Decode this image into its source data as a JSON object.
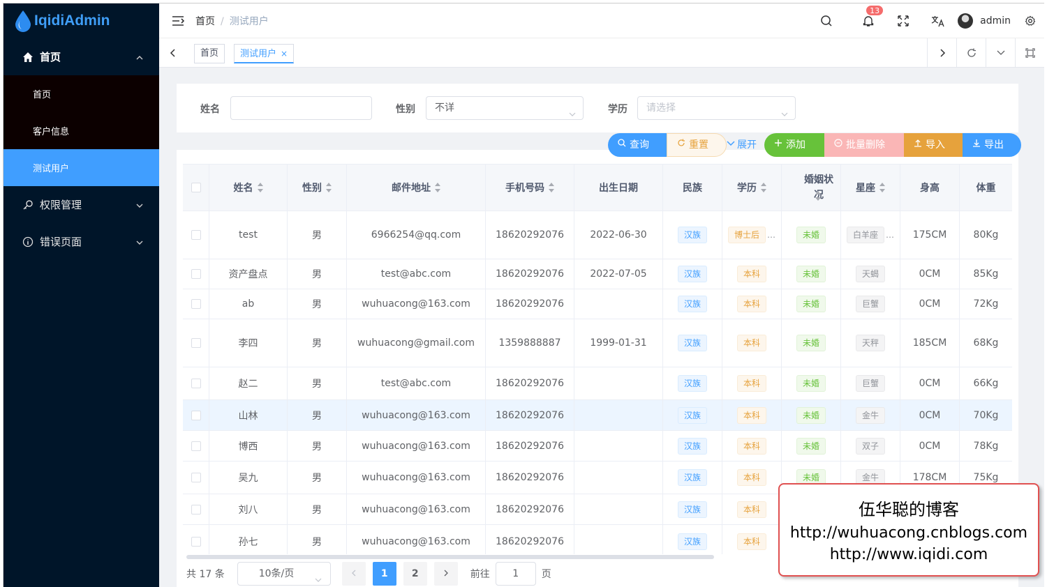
{
  "app": {
    "title": "IqidiAdmin"
  },
  "sidebar": {
    "home": "首页",
    "sub_items": [
      "首页",
      "客户信息",
      "测试用户"
    ],
    "permissions": "权限管理",
    "errors": "错误页面"
  },
  "header": {
    "breadcrumb_home": "首页",
    "breadcrumb_sep": "/",
    "breadcrumb_current": "测试用户",
    "notify_count": "13",
    "username": "admin"
  },
  "tags": {
    "home": "首页",
    "current": "测试用户",
    "close": "×"
  },
  "search": {
    "name_label": "姓名",
    "name_value": "",
    "gender_label": "性别",
    "gender_value": "不详",
    "edu_label": "学历",
    "edu_placeholder": "请选择"
  },
  "buttons": {
    "query": "查询",
    "reset": "重置",
    "expand": "展开",
    "add": "添加",
    "batch_delete": "批量删除",
    "import": "导入",
    "export": "导出"
  },
  "table": {
    "headers": [
      "姓名",
      "性别",
      "邮件地址",
      "手机号码",
      "出生日期",
      "民族",
      "学历",
      "婚姻状况",
      "星座",
      "身高",
      "体重"
    ],
    "rows": [
      {
        "name": "test",
        "gender": "男",
        "email": "6966254@qq.com",
        "phone": "18620292076",
        "birth": "2022-06-30",
        "nation": "汉族",
        "edu": "博士后",
        "marital": "未婚",
        "star": "白羊座",
        "height": "175CM",
        "weight": "80Kg"
      },
      {
        "name": "资产盘点",
        "gender": "男",
        "email": "test@abc.com",
        "phone": "18620292076",
        "birth": "2022-07-05",
        "nation": "汉族",
        "edu": "本科",
        "marital": "未婚",
        "star": "天蝎",
        "height": "0CM",
        "weight": "85Kg"
      },
      {
        "name": "ab",
        "gender": "男",
        "email": "wuhuacong@163.com",
        "phone": "18620292076",
        "birth": "",
        "nation": "汉族",
        "edu": "本科",
        "marital": "未婚",
        "star": "巨蟹",
        "height": "0CM",
        "weight": "72Kg"
      },
      {
        "name": "李四",
        "gender": "男",
        "email": "wuhuacong@gmail.com",
        "phone": "1359888887",
        "birth": "1999-01-31",
        "nation": "汉族",
        "edu": "本科",
        "marital": "未婚",
        "star": "天秤",
        "height": "185CM",
        "weight": "68Kg"
      },
      {
        "name": "赵二",
        "gender": "男",
        "email": "test@abc.com",
        "phone": "18620292076",
        "birth": "",
        "nation": "汉族",
        "edu": "本科",
        "marital": "未婚",
        "star": "巨蟹",
        "height": "0CM",
        "weight": "66Kg"
      },
      {
        "name": "山林",
        "gender": "男",
        "email": "wuhuacong@163.com",
        "phone": "18620292076",
        "birth": "",
        "nation": "汉族",
        "edu": "本科",
        "marital": "未婚",
        "star": "金牛",
        "height": "0CM",
        "weight": "70Kg"
      },
      {
        "name": "博西",
        "gender": "男",
        "email": "wuhuacong@163.com",
        "phone": "18620292076",
        "birth": "",
        "nation": "汉族",
        "edu": "本科",
        "marital": "未婚",
        "star": "双子",
        "height": "0CM",
        "weight": "78Kg"
      },
      {
        "name": "吴九",
        "gender": "男",
        "email": "wuhuacong@163.com",
        "phone": "18620292076",
        "birth": "",
        "nation": "汉族",
        "edu": "本科",
        "marital": "未婚",
        "star": "金牛",
        "height": "178CM",
        "weight": "75Kg"
      },
      {
        "name": "刘八",
        "gender": "男",
        "email": "wuhuacong@163.com",
        "phone": "18620292076",
        "birth": "",
        "nation": "汉族",
        "edu": "本科",
        "marital": "",
        "star": "",
        "height": "",
        "weight": ""
      },
      {
        "name": "孙七",
        "gender": "男",
        "email": "wuhuacong@163.com",
        "phone": "18620292076",
        "birth": "",
        "nation": "汉族",
        "edu": "本科",
        "marital": "",
        "star": "",
        "height": "",
        "weight": ""
      }
    ]
  },
  "pagination": {
    "total": "共 17 条",
    "page_size": "10条/页",
    "pages": [
      "1",
      "2"
    ],
    "goto_label": "前往",
    "goto_value": "1",
    "page_unit": "页"
  },
  "watermark": {
    "title": "伍华聪的博客",
    "url1": "http://wuhuacong.cnblogs.com",
    "url2": "http://www.iqidi.com"
  },
  "colors": {
    "primary": "#409eff",
    "sidebar": "#001529",
    "success": "#67c23a",
    "warning": "#e6a23c",
    "danger_light": "#fab6b6"
  }
}
